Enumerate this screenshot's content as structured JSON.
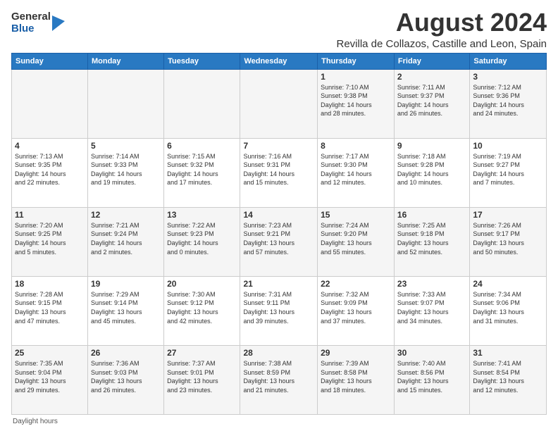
{
  "logo": {
    "general": "General",
    "blue": "Blue"
  },
  "title": "August 2024",
  "subtitle": "Revilla de Collazos, Castille and Leon, Spain",
  "days_header": [
    "Sunday",
    "Monday",
    "Tuesday",
    "Wednesday",
    "Thursday",
    "Friday",
    "Saturday"
  ],
  "weeks": [
    [
      {
        "day": "",
        "info": ""
      },
      {
        "day": "",
        "info": ""
      },
      {
        "day": "",
        "info": ""
      },
      {
        "day": "",
        "info": ""
      },
      {
        "day": "1",
        "info": "Sunrise: 7:10 AM\nSunset: 9:38 PM\nDaylight: 14 hours\nand 28 minutes."
      },
      {
        "day": "2",
        "info": "Sunrise: 7:11 AM\nSunset: 9:37 PM\nDaylight: 14 hours\nand 26 minutes."
      },
      {
        "day": "3",
        "info": "Sunrise: 7:12 AM\nSunset: 9:36 PM\nDaylight: 14 hours\nand 24 minutes."
      }
    ],
    [
      {
        "day": "4",
        "info": "Sunrise: 7:13 AM\nSunset: 9:35 PM\nDaylight: 14 hours\nand 22 minutes."
      },
      {
        "day": "5",
        "info": "Sunrise: 7:14 AM\nSunset: 9:33 PM\nDaylight: 14 hours\nand 19 minutes."
      },
      {
        "day": "6",
        "info": "Sunrise: 7:15 AM\nSunset: 9:32 PM\nDaylight: 14 hours\nand 17 minutes."
      },
      {
        "day": "7",
        "info": "Sunrise: 7:16 AM\nSunset: 9:31 PM\nDaylight: 14 hours\nand 15 minutes."
      },
      {
        "day": "8",
        "info": "Sunrise: 7:17 AM\nSunset: 9:30 PM\nDaylight: 14 hours\nand 12 minutes."
      },
      {
        "day": "9",
        "info": "Sunrise: 7:18 AM\nSunset: 9:28 PM\nDaylight: 14 hours\nand 10 minutes."
      },
      {
        "day": "10",
        "info": "Sunrise: 7:19 AM\nSunset: 9:27 PM\nDaylight: 14 hours\nand 7 minutes."
      }
    ],
    [
      {
        "day": "11",
        "info": "Sunrise: 7:20 AM\nSunset: 9:25 PM\nDaylight: 14 hours\nand 5 minutes."
      },
      {
        "day": "12",
        "info": "Sunrise: 7:21 AM\nSunset: 9:24 PM\nDaylight: 14 hours\nand 2 minutes."
      },
      {
        "day": "13",
        "info": "Sunrise: 7:22 AM\nSunset: 9:23 PM\nDaylight: 14 hours\nand 0 minutes."
      },
      {
        "day": "14",
        "info": "Sunrise: 7:23 AM\nSunset: 9:21 PM\nDaylight: 13 hours\nand 57 minutes."
      },
      {
        "day": "15",
        "info": "Sunrise: 7:24 AM\nSunset: 9:20 PM\nDaylight: 13 hours\nand 55 minutes."
      },
      {
        "day": "16",
        "info": "Sunrise: 7:25 AM\nSunset: 9:18 PM\nDaylight: 13 hours\nand 52 minutes."
      },
      {
        "day": "17",
        "info": "Sunrise: 7:26 AM\nSunset: 9:17 PM\nDaylight: 13 hours\nand 50 minutes."
      }
    ],
    [
      {
        "day": "18",
        "info": "Sunrise: 7:28 AM\nSunset: 9:15 PM\nDaylight: 13 hours\nand 47 minutes."
      },
      {
        "day": "19",
        "info": "Sunrise: 7:29 AM\nSunset: 9:14 PM\nDaylight: 13 hours\nand 45 minutes."
      },
      {
        "day": "20",
        "info": "Sunrise: 7:30 AM\nSunset: 9:12 PM\nDaylight: 13 hours\nand 42 minutes."
      },
      {
        "day": "21",
        "info": "Sunrise: 7:31 AM\nSunset: 9:11 PM\nDaylight: 13 hours\nand 39 minutes."
      },
      {
        "day": "22",
        "info": "Sunrise: 7:32 AM\nSunset: 9:09 PM\nDaylight: 13 hours\nand 37 minutes."
      },
      {
        "day": "23",
        "info": "Sunrise: 7:33 AM\nSunset: 9:07 PM\nDaylight: 13 hours\nand 34 minutes."
      },
      {
        "day": "24",
        "info": "Sunrise: 7:34 AM\nSunset: 9:06 PM\nDaylight: 13 hours\nand 31 minutes."
      }
    ],
    [
      {
        "day": "25",
        "info": "Sunrise: 7:35 AM\nSunset: 9:04 PM\nDaylight: 13 hours\nand 29 minutes."
      },
      {
        "day": "26",
        "info": "Sunrise: 7:36 AM\nSunset: 9:03 PM\nDaylight: 13 hours\nand 26 minutes."
      },
      {
        "day": "27",
        "info": "Sunrise: 7:37 AM\nSunset: 9:01 PM\nDaylight: 13 hours\nand 23 minutes."
      },
      {
        "day": "28",
        "info": "Sunrise: 7:38 AM\nSunset: 8:59 PM\nDaylight: 13 hours\nand 21 minutes."
      },
      {
        "day": "29",
        "info": "Sunrise: 7:39 AM\nSunset: 8:58 PM\nDaylight: 13 hours\nand 18 minutes."
      },
      {
        "day": "30",
        "info": "Sunrise: 7:40 AM\nSunset: 8:56 PM\nDaylight: 13 hours\nand 15 minutes."
      },
      {
        "day": "31",
        "info": "Sunrise: 7:41 AM\nSunset: 8:54 PM\nDaylight: 13 hours\nand 12 minutes."
      }
    ]
  ],
  "footer": "Daylight hours"
}
